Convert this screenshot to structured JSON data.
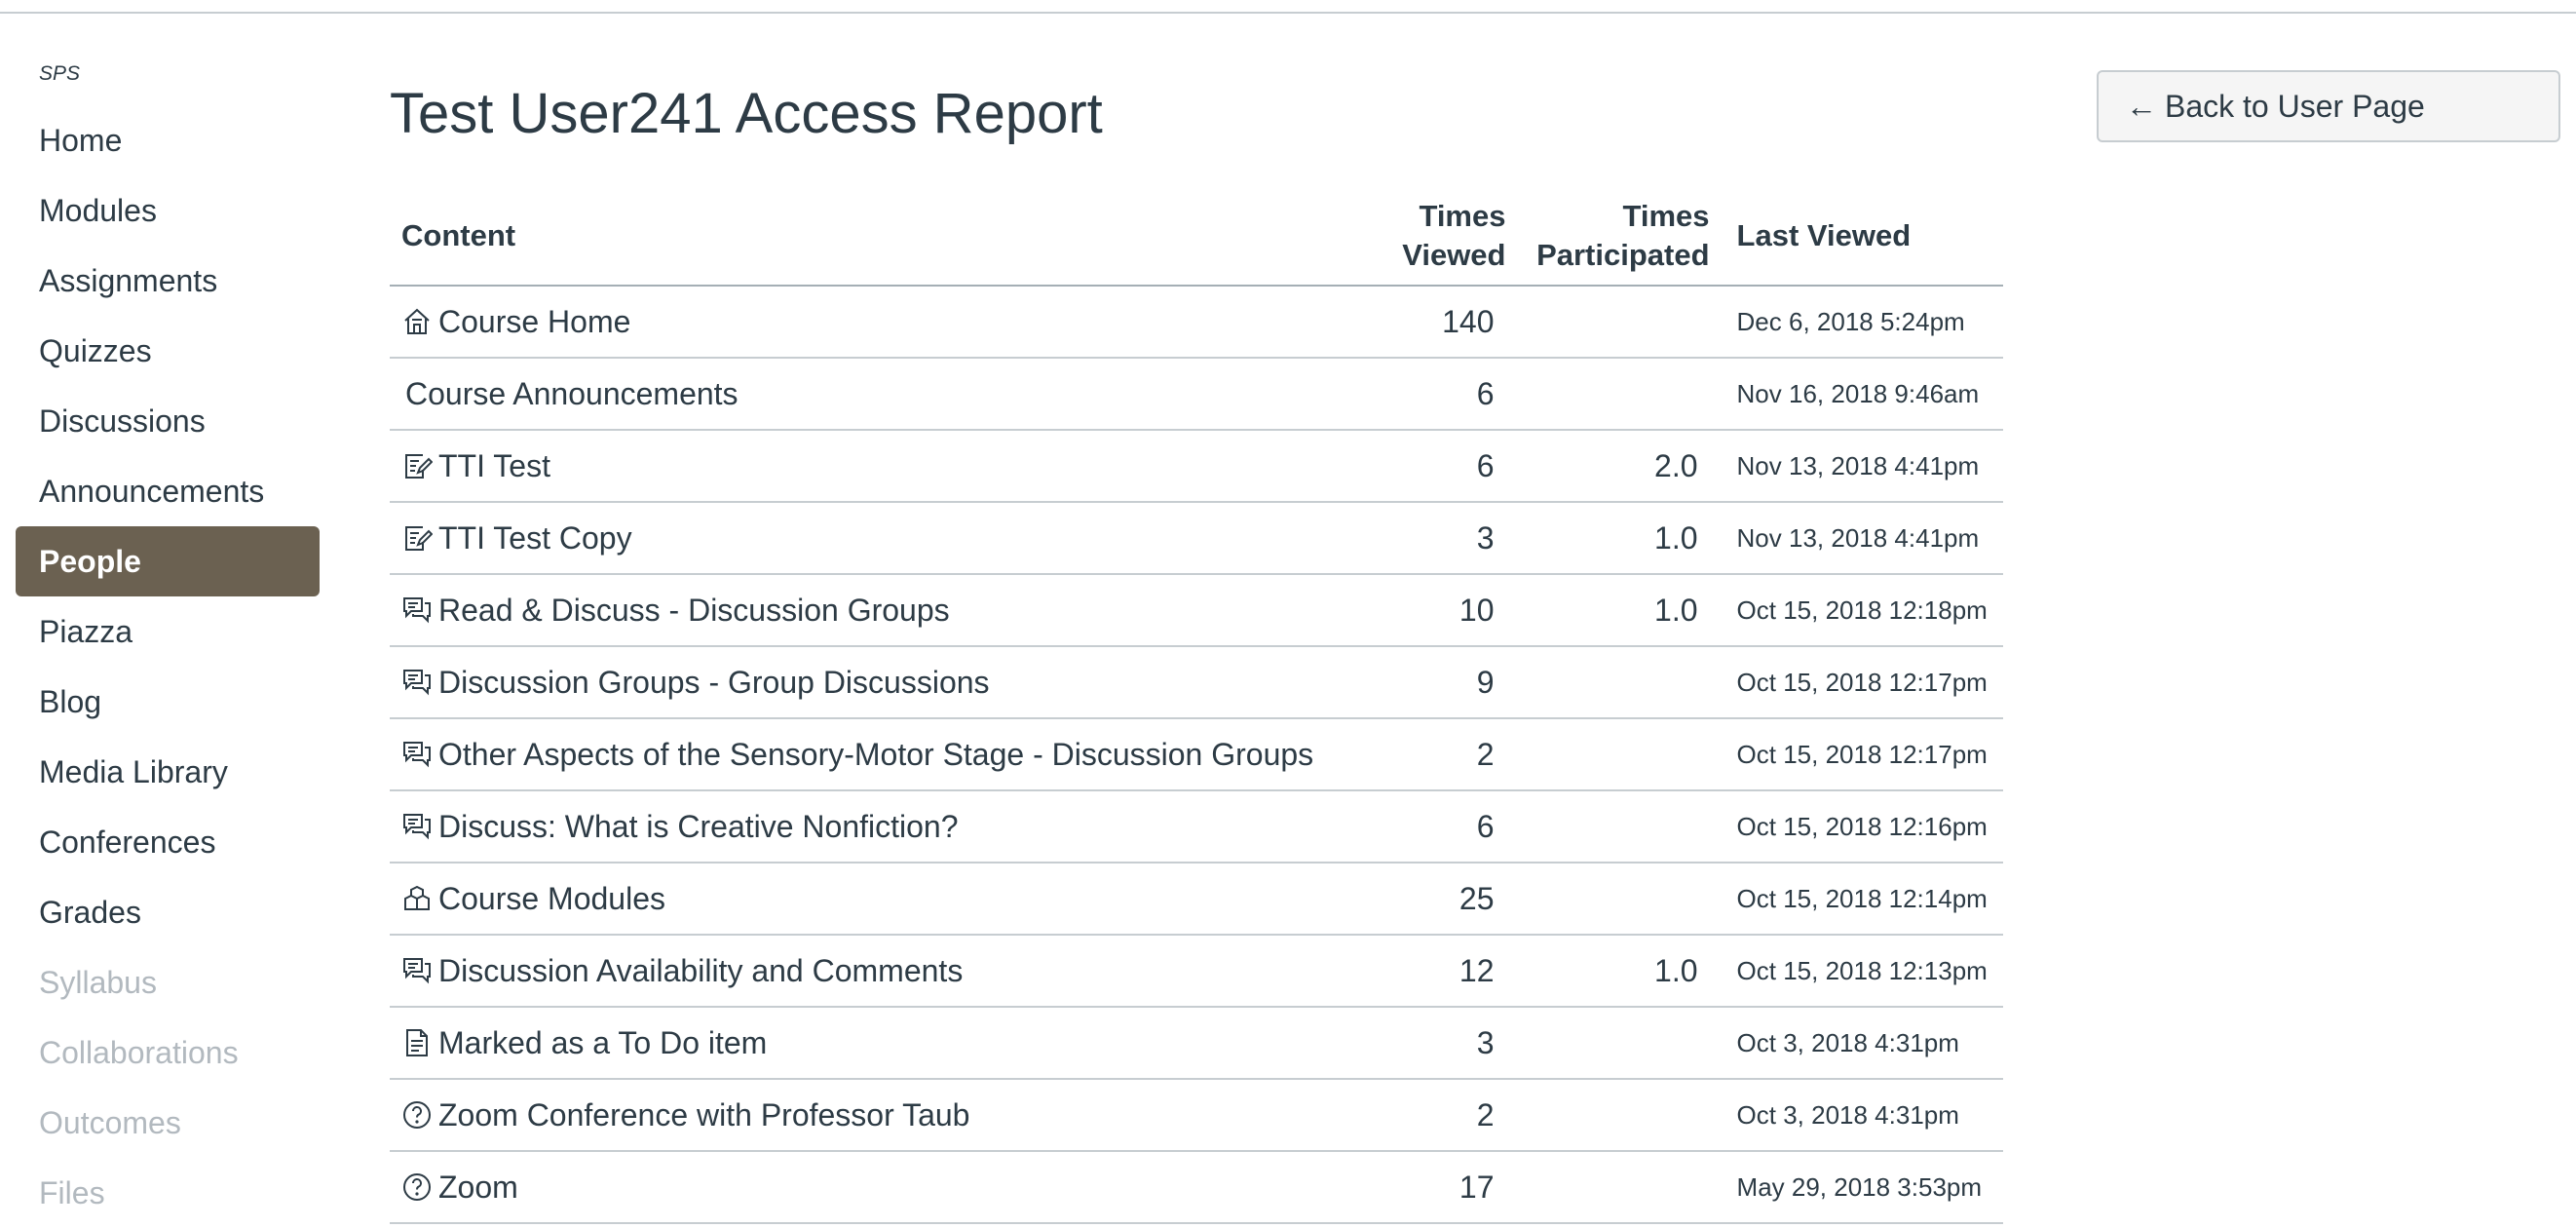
{
  "sidebar": {
    "course_code": "SPS",
    "items": [
      {
        "label": "Home",
        "state": "normal"
      },
      {
        "label": "Modules",
        "state": "normal"
      },
      {
        "label": "Assignments",
        "state": "normal"
      },
      {
        "label": "Quizzes",
        "state": "normal"
      },
      {
        "label": "Discussions",
        "state": "normal"
      },
      {
        "label": "Announcements",
        "state": "normal"
      },
      {
        "label": "People",
        "state": "active"
      },
      {
        "label": "Piazza",
        "state": "normal"
      },
      {
        "label": "Blog",
        "state": "normal"
      },
      {
        "label": "Media Library",
        "state": "normal"
      },
      {
        "label": "Conferences",
        "state": "normal"
      },
      {
        "label": "Grades",
        "state": "normal"
      },
      {
        "label": "Syllabus",
        "state": "disabled"
      },
      {
        "label": "Collaborations",
        "state": "disabled"
      },
      {
        "label": "Outcomes",
        "state": "disabled"
      },
      {
        "label": "Files",
        "state": "disabled"
      }
    ]
  },
  "page": {
    "title": "Test User241 Access Report",
    "back_button": {
      "arrow": "←",
      "label": "Back to User Page"
    }
  },
  "table": {
    "headers": {
      "content": "Content",
      "times_viewed": [
        "Times",
        "Viewed"
      ],
      "times_participated": [
        "Times",
        "Participated"
      ],
      "last_viewed": "Last Viewed"
    },
    "rows": [
      {
        "icon": "home-icon",
        "content": "Course Home",
        "views": "140",
        "participations": "",
        "last_viewed": "Dec 6, 2018 5:24pm"
      },
      {
        "icon": "",
        "content": "Course Announcements",
        "views": "6",
        "participations": "",
        "last_viewed": "Nov 16, 2018 9:46am"
      },
      {
        "icon": "quiz-icon",
        "content": "TTI Test",
        "views": "6",
        "participations": "2.0",
        "last_viewed": "Nov 13, 2018 4:41pm"
      },
      {
        "icon": "quiz-icon",
        "content": "TTI Test Copy",
        "views": "3",
        "participations": "1.0",
        "last_viewed": "Nov 13, 2018 4:41pm"
      },
      {
        "icon": "discussion-icon",
        "content": "Read & Discuss - Discussion Groups",
        "views": "10",
        "participations": "1.0",
        "last_viewed": "Oct 15, 2018 12:18pm"
      },
      {
        "icon": "discussion-icon",
        "content": "Discussion Groups - Group Discussions",
        "views": "9",
        "participations": "",
        "last_viewed": "Oct 15, 2018 12:17pm"
      },
      {
        "icon": "discussion-icon",
        "content": "Other Aspects of the Sensory-Motor Stage - Discussion Groups",
        "views": "2",
        "participations": "",
        "last_viewed": "Oct 15, 2018 12:17pm"
      },
      {
        "icon": "discussion-icon",
        "content": "Discuss: What is Creative Nonfiction?",
        "views": "6",
        "participations": "",
        "last_viewed": "Oct 15, 2018 12:16pm"
      },
      {
        "icon": "modules-icon",
        "content": "Course Modules",
        "views": "25",
        "participations": "",
        "last_viewed": "Oct 15, 2018 12:14pm"
      },
      {
        "icon": "discussion-icon",
        "content": "Discussion Availability and Comments",
        "views": "12",
        "participations": "1.0",
        "last_viewed": "Oct 15, 2018 12:13pm"
      },
      {
        "icon": "document-icon",
        "content": "Marked as a To Do item",
        "views": "3",
        "participations": "",
        "last_viewed": "Oct 3, 2018 4:31pm"
      },
      {
        "icon": "question-icon",
        "content": "Zoom Conference with Professor Taub",
        "views": "2",
        "participations": "",
        "last_viewed": "Oct 3, 2018 4:31pm"
      },
      {
        "icon": "question-icon",
        "content": "Zoom",
        "views": "17",
        "participations": "",
        "last_viewed": "May 29, 2018 3:53pm"
      }
    ]
  },
  "colors": {
    "text": "#2d3b45",
    "active_nav_bg": "#6b6151",
    "disabled_nav": "#b2b9bf",
    "row_border": "#c7cdd1"
  }
}
